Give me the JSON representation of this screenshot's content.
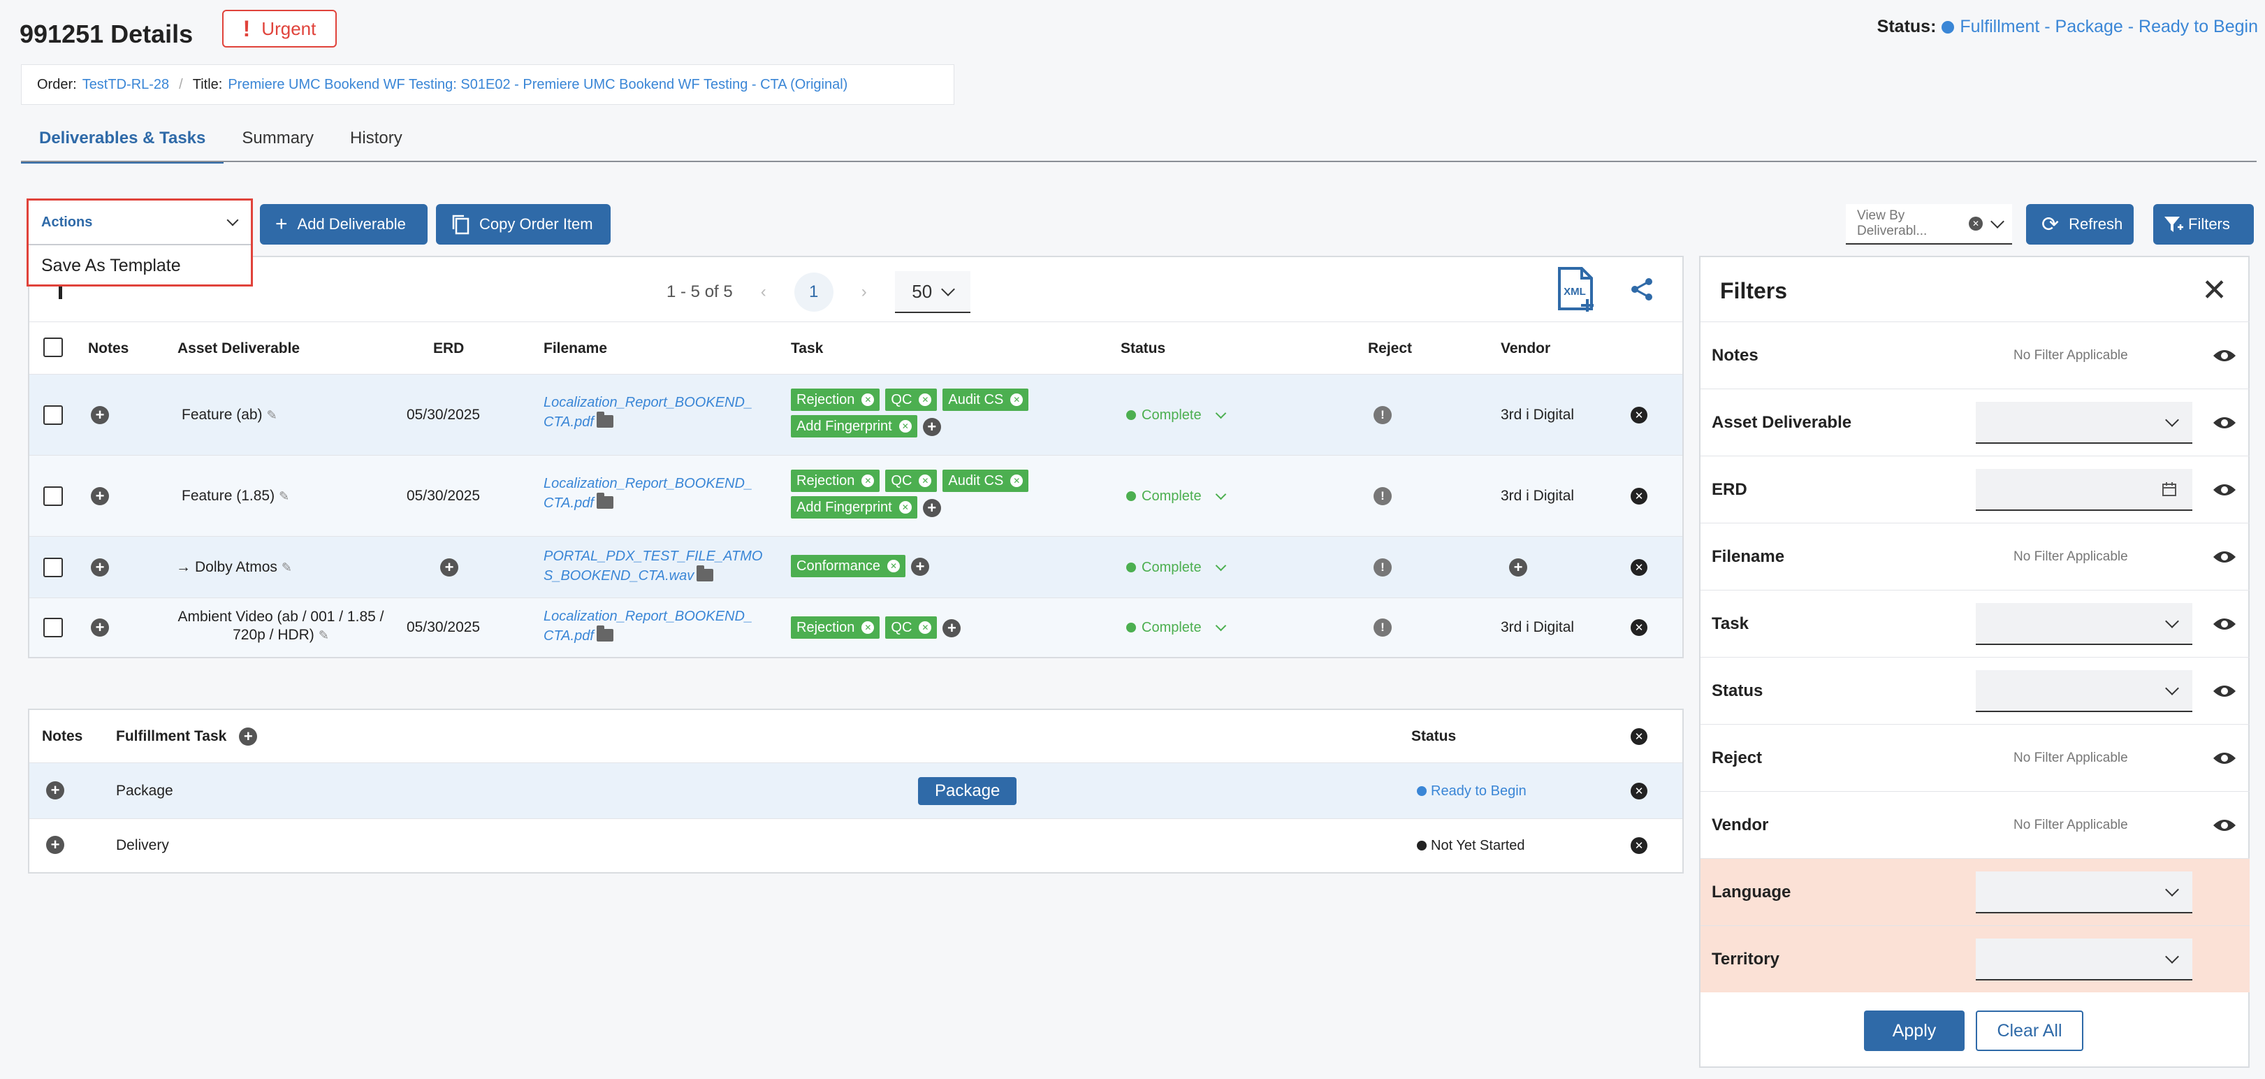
{
  "header": {
    "title": "991251 Details",
    "urgent_label": "Urgent",
    "status_label": "Status:",
    "status_value": "Fulfillment - Package - Ready to Begin"
  },
  "breadcrumb": {
    "order_label": "Order:",
    "order_value": "TestTD-RL-28",
    "title_label": "Title:",
    "title_value": "Premiere UMC Bookend WF Testing: S01E02 - Premiere UMC Bookend WF Testing - CTA (Original)"
  },
  "tabs": [
    {
      "label": "Deliverables & Tasks"
    },
    {
      "label": "Summary"
    },
    {
      "label": "History"
    }
  ],
  "toolbar": {
    "actions_label": "Actions",
    "actions_option": "Save As Template",
    "add_deliverable": "Add Deliverable",
    "copy_order_item": "Copy Order Item",
    "view_by": "View By Deliverabl...",
    "refresh": "Refresh",
    "filters": "Filters"
  },
  "pager": {
    "range": "1 - 5 of 5",
    "current_page": "1",
    "page_size": "50",
    "xml_label": "XML"
  },
  "deliverables": {
    "columns": [
      "Notes",
      "Asset Deliverable",
      "ERD",
      "Filename",
      "Task",
      "Status",
      "Reject",
      "Vendor"
    ],
    "rows": [
      {
        "asset": "Feature (ab)",
        "erd": "05/30/2025",
        "filename": "Localization_Report_BOOKEND_CTA.pdf",
        "tasks": [
          "Rejection",
          "QC",
          "Audit CS",
          "Add Fingerprint"
        ],
        "status": "Complete",
        "vendor": "3rd i Digital"
      },
      {
        "asset": "Feature (1.85)",
        "erd": "05/30/2025",
        "filename": "Localization_Report_BOOKEND_CTA.pdf",
        "tasks": [
          "Rejection",
          "QC",
          "Audit CS",
          "Add Fingerprint"
        ],
        "status": "Complete",
        "vendor": "3rd i Digital"
      },
      {
        "asset": "Dolby Atmos",
        "erd": "",
        "filename": "PORTAL_PDX_TEST_FILE_ATMOS_BOOKEND_CTA.wav",
        "tasks": [
          "Conformance"
        ],
        "status": "Complete",
        "vendor": ""
      },
      {
        "asset": "Ambient Video (ab / 001 / 1.85 / 720p / HDR)",
        "erd": "05/30/2025",
        "filename": "Localization_Report_BOOKEND_CTA.pdf",
        "tasks": [
          "Rejection",
          "QC"
        ],
        "status": "Complete",
        "vendor": "3rd i Digital"
      }
    ]
  },
  "fulfillment": {
    "columns": [
      "Notes",
      "Fulfillment Task",
      "Status"
    ],
    "rows": [
      {
        "task": "Package",
        "button": "Package",
        "status": "Ready to Begin",
        "status_color": "#3a86d6"
      },
      {
        "task": "Delivery",
        "button": "",
        "status": "Not Yet Started",
        "status_color": "#222222"
      }
    ]
  },
  "filters": {
    "title": "Filters",
    "no_filter_text": "No Filter Applicable",
    "rows": [
      {
        "label": "Notes",
        "type": "none"
      },
      {
        "label": "Asset Deliverable",
        "type": "select"
      },
      {
        "label": "ERD",
        "type": "date"
      },
      {
        "label": "Filename",
        "type": "none"
      },
      {
        "label": "Task",
        "type": "select"
      },
      {
        "label": "Status",
        "type": "select"
      },
      {
        "label": "Reject",
        "type": "none"
      },
      {
        "label": "Vendor",
        "type": "none"
      },
      {
        "label": "Language",
        "type": "select"
      },
      {
        "label": "Territory",
        "type": "select"
      }
    ],
    "apply": "Apply",
    "clear_all": "Clear All"
  },
  "colors": {
    "accent": "#2f6aa8",
    "link": "#3a86d6",
    "urgent": "#e0433b",
    "task_tag": "#4caf50",
    "highlight_row": "#fbe1d6"
  }
}
